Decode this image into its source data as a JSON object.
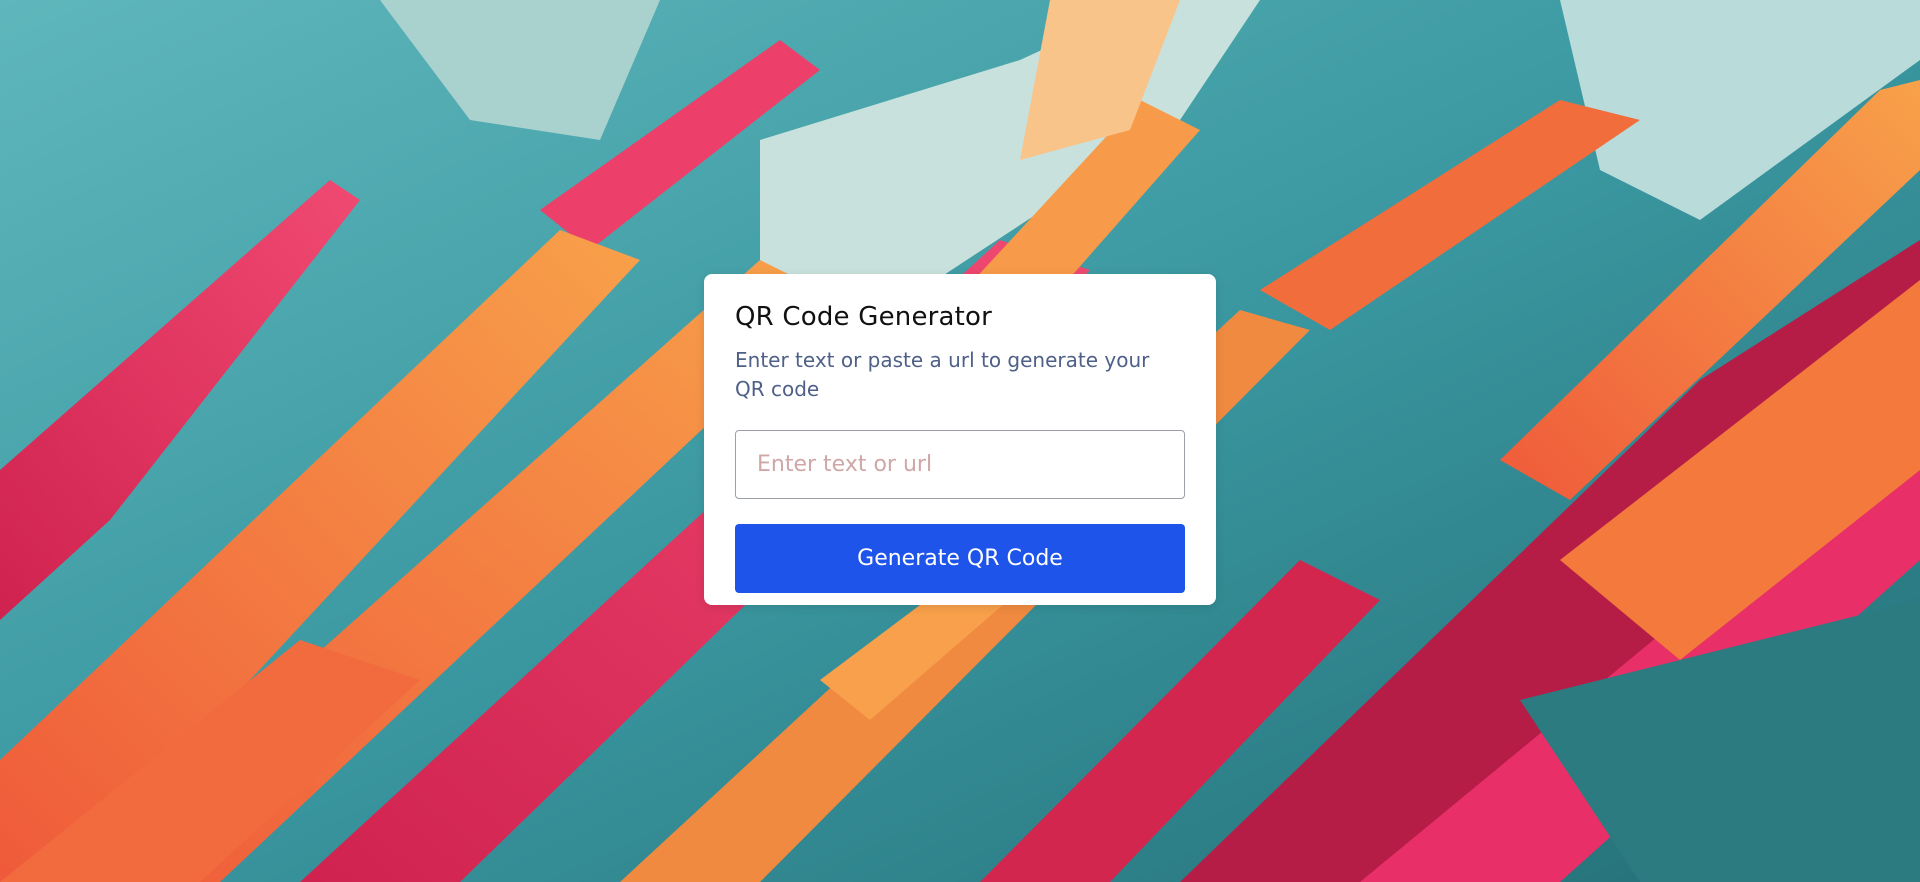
{
  "card": {
    "title": "QR Code Generator",
    "subtitle": "Enter text or paste a url to generate your QR code"
  },
  "input": {
    "value": "",
    "placeholder": "Enter text or url"
  },
  "button": {
    "label": "Generate QR Code"
  },
  "colors": {
    "button_bg": "#1f54ea",
    "subtitle_text": "#4f6088",
    "placeholder_text": "#cfa7a7",
    "bg_teal": "#3f9aa3",
    "bg_orange": "#f37a3c",
    "bg_pink": "#e83566",
    "bg_crimson": "#b81c45"
  }
}
